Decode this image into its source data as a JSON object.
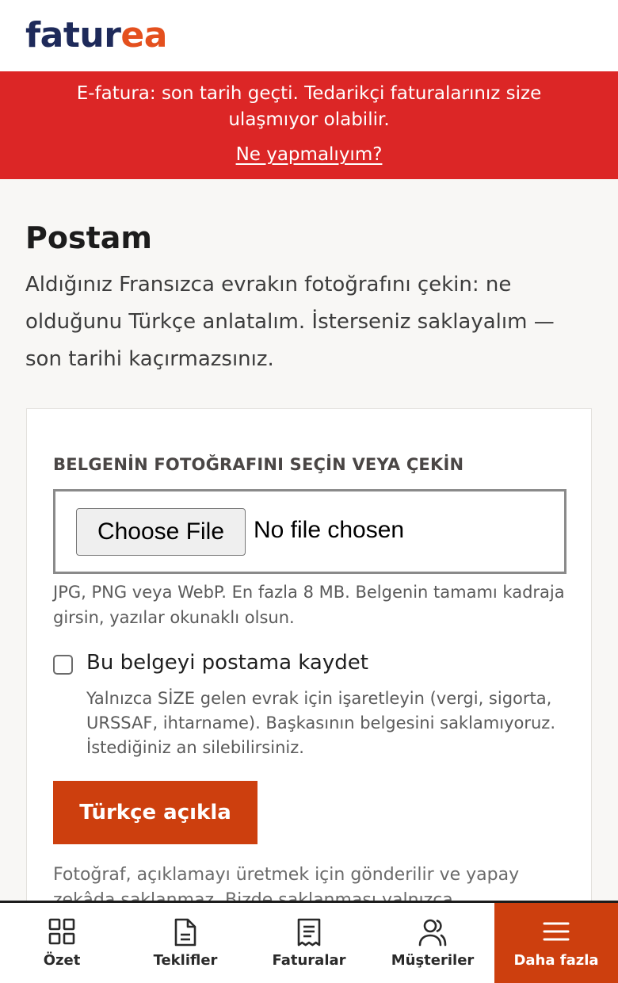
{
  "header": {
    "logo_part1": "fatur",
    "logo_part2": "ea"
  },
  "banner": {
    "message": "E-fatura: son tarih geçti. Tedarikçi faturalarınız size ulaşmıyor olabilir.",
    "link": "Ne yapmalıyım?"
  },
  "page": {
    "title": "Postam",
    "intro": "Aldığınız Fransızca evrakın fotoğrafını çekin: ne olduğunu Türkçe anlatalım. İsterseniz saklayalım — son tarihi kaçırmazsınız."
  },
  "form": {
    "field_label": "BELGENİN FOTOĞRAFINI SEÇİN VEYA ÇEKİN",
    "file_button": "Choose File",
    "file_status": "No file chosen",
    "file_hint": "JPG, PNG veya WebP. En fazla 8 MB. Belgenin tamamı kadraja girsin, yazılar okunaklı olsun.",
    "checkbox_label": "Bu belgeyi postama kaydet",
    "checkbox_checked": false,
    "checkbox_hint": "Yalnızca SİZE gelen evrak için işaretleyin (vergi, sigorta, URSSAF, ihtarname). Başkasının belgesini saklamıyoruz. İstediğiniz an silebilirsiniz.",
    "submit": "Türkçe açıkla",
    "footer_note": "Fotoğraf, açıklamayı üretmek için gönderilir ve yapay zekâda saklanmaz. Bizde saklanması yalnızca"
  },
  "bottom_nav": {
    "items": [
      {
        "label": "Özet",
        "icon": "grid-icon"
      },
      {
        "label": "Teklifler",
        "icon": "document-icon"
      },
      {
        "label": "Faturalar",
        "icon": "receipt-icon"
      },
      {
        "label": "Müşteriler",
        "icon": "users-icon"
      },
      {
        "label": "Daha fazla",
        "icon": "menu-icon",
        "active": true
      }
    ]
  },
  "colors": {
    "brand_navy": "#1e2a5a",
    "brand_orange": "#e4501e",
    "banner_red": "#dc2626",
    "primary_button": "#cd3f0e"
  }
}
